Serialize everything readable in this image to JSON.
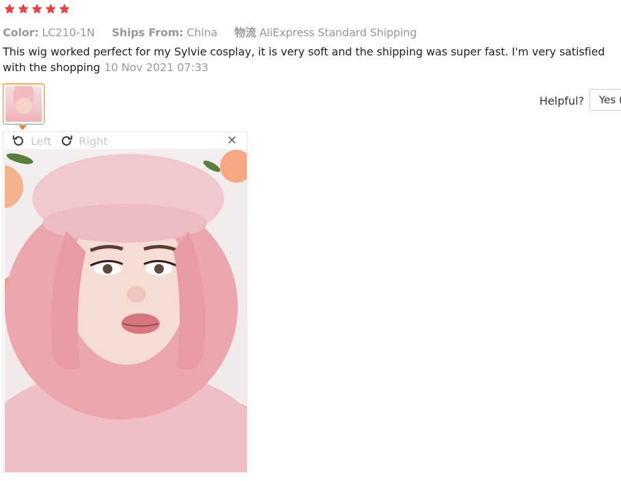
{
  "rating": {
    "stars": 5,
    "color": "#e84444"
  },
  "meta": {
    "color_label": "Color:",
    "color_value": "LC210-1N",
    "ships_label": "Ships From:",
    "ships_value": "China",
    "logistics_label": "物流",
    "logistics_value": "AliExpress Standard Shipping"
  },
  "review": {
    "text": "This wig worked perfect for my Sylvie cosplay, it is very soft and the shipping was super fast. I'm very satisfied with the shopping",
    "date": "10 Nov 2021 07:33"
  },
  "helpful": {
    "label": "Helpful?",
    "yes_label": "Yes ("
  },
  "viewer": {
    "rotate_left_label": "Left",
    "rotate_right_label": "Right",
    "close_label": "✕"
  },
  "colors": {
    "accent": "#f27d1a"
  }
}
